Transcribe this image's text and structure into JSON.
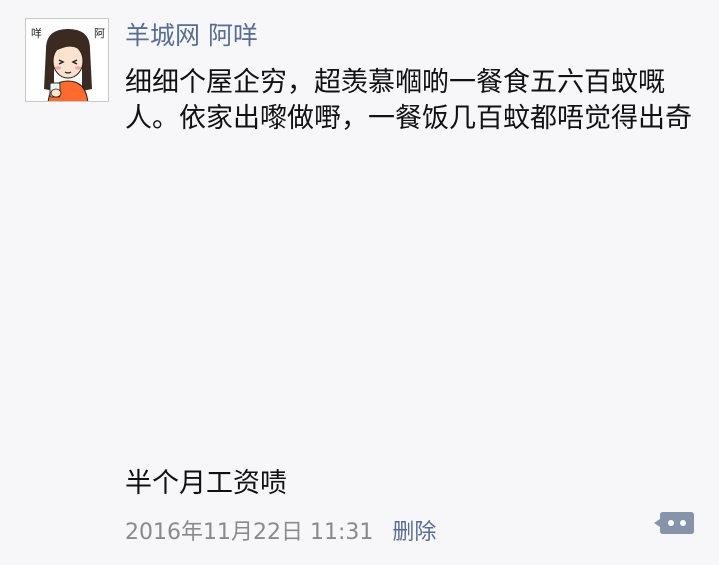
{
  "post": {
    "author": "羊城网 阿咩",
    "text": "细细个屋企穷，超羡慕嗰啲一餐食五六百蚊嘅人。依家出嚟做嘢，一餐饭几百蚊都唔觉得出奇",
    "caption": "半个月工资啧",
    "timestamp": "2016年11月22日 11:31",
    "delete_label": "删除"
  },
  "avatar": {
    "icon": "cartoon-girl-avatar",
    "label_left": "咩",
    "label_right": "阿"
  },
  "colors": {
    "background": "#f7f7fa",
    "link": "#586c94",
    "text": "#111111",
    "muted": "#8a8a8a",
    "comment_button": "#8594a8"
  }
}
